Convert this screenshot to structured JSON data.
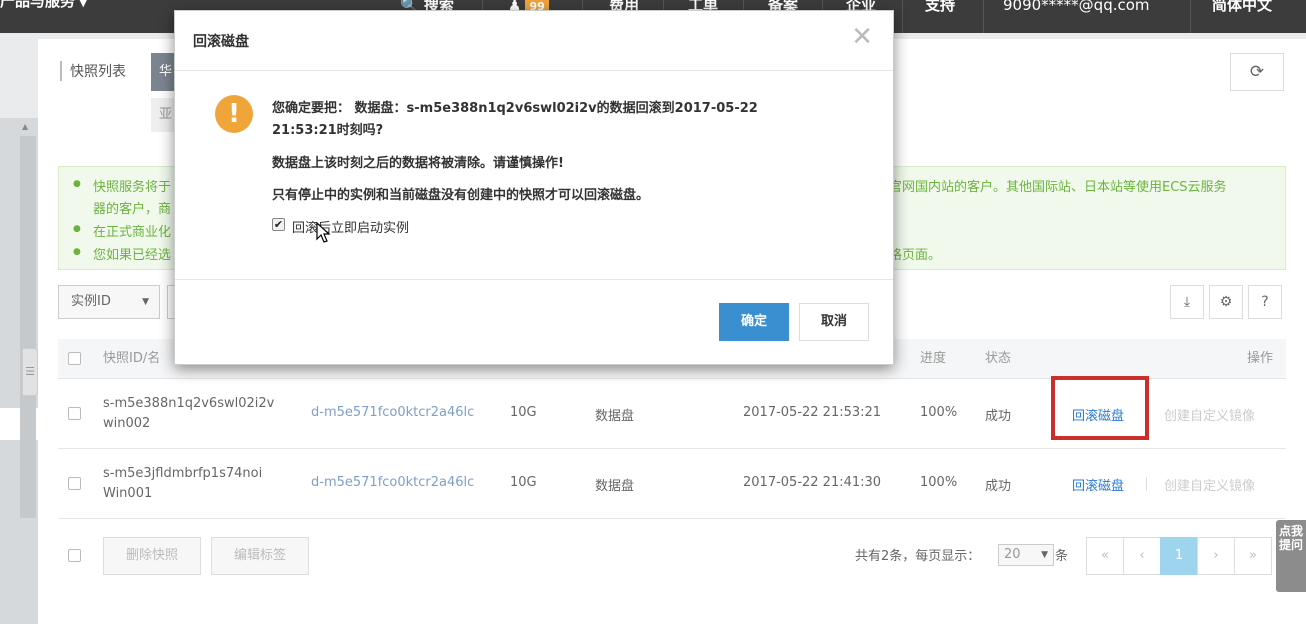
{
  "topbar": {
    "brand": "产品与服务",
    "search": "搜索",
    "badge": "99",
    "nav": [
      "费用",
      "工单",
      "备案",
      "企业",
      "支持"
    ],
    "account": "9090*****@qq.com",
    "language": "简体中文"
  },
  "page": {
    "title": "快照列表",
    "region_tab_1": "华",
    "region_tab_2": "亚"
  },
  "notice": {
    "line1a": "快照服务将于",
    "line1b": "官网国内站的客户。其他国际站、日本站等使用ECS云服务",
    "line1c": "器的客户，商",
    "line2": "在正式商业化",
    "line3a": "您如果已经选",
    "line3b": "格页面。"
  },
  "filter": {
    "select_value": "实例ID"
  },
  "table": {
    "headers": {
      "id_name": "快照ID/名",
      "progress": "进度",
      "status": "状态",
      "actions": "操作"
    },
    "rows": [
      {
        "id": "s-m5e388n1q2v6swl02i2v",
        "name": "win002",
        "disk": "d-m5e571fco0ktcr2a46lc",
        "size": "10G",
        "type": "数据盘",
        "time": "2017-05-22 21:53:21",
        "progress": "100%",
        "status": "成功",
        "rollback": "回滚磁盘",
        "create_image": "创建自定义镜像"
      },
      {
        "id": "s-m5e3jfldmbrfp1s74noi",
        "name": "Win001",
        "disk": "d-m5e571fco0ktcr2a46lc",
        "size": "10G",
        "type": "数据盘",
        "time": "2017-05-22 21:41:30",
        "progress": "100%",
        "status": "成功",
        "rollback": "回滚磁盘",
        "create_image": "创建自定义镜像"
      }
    ]
  },
  "footer": {
    "delete_btn": "删除快照",
    "edit_tags_btn": "编辑标签",
    "total": "共有2条，每页显示：",
    "page_size": "20",
    "unit": "条",
    "first": "«",
    "prev": "‹",
    "current": "1",
    "next": "›",
    "last": "»"
  },
  "feedback": "点我提问",
  "modal": {
    "title": "回滚磁盘",
    "line1": "您确定要把：  数据盘：s-m5e388n1q2v6swl02i2v的数据回滚到2017-05-22",
    "line2": "21:53:21时刻吗?",
    "line3": "数据盘上该时刻之后的数据将被清除。请谨慎操作!",
    "line4": "只有停止中的实例和当前磁盘没有创建中的快照才可以回滚磁盘。",
    "checkbox_label": "回滚后立即启动实例",
    "checkbox_checked": true,
    "ok": "确定",
    "cancel": "取消"
  },
  "colors": {
    "topbar": "#3c3c3c",
    "primary": "#3a8fd0",
    "warning": "#f0a53a",
    "highlight_box": "#c9302c",
    "notice_text": "#6cb33e"
  },
  "icons": [
    "search-icon",
    "bell-icon",
    "refresh-icon",
    "close-icon",
    "warning-icon",
    "export-icon",
    "gear-icon",
    "help-icon",
    "cursor-icon"
  ]
}
